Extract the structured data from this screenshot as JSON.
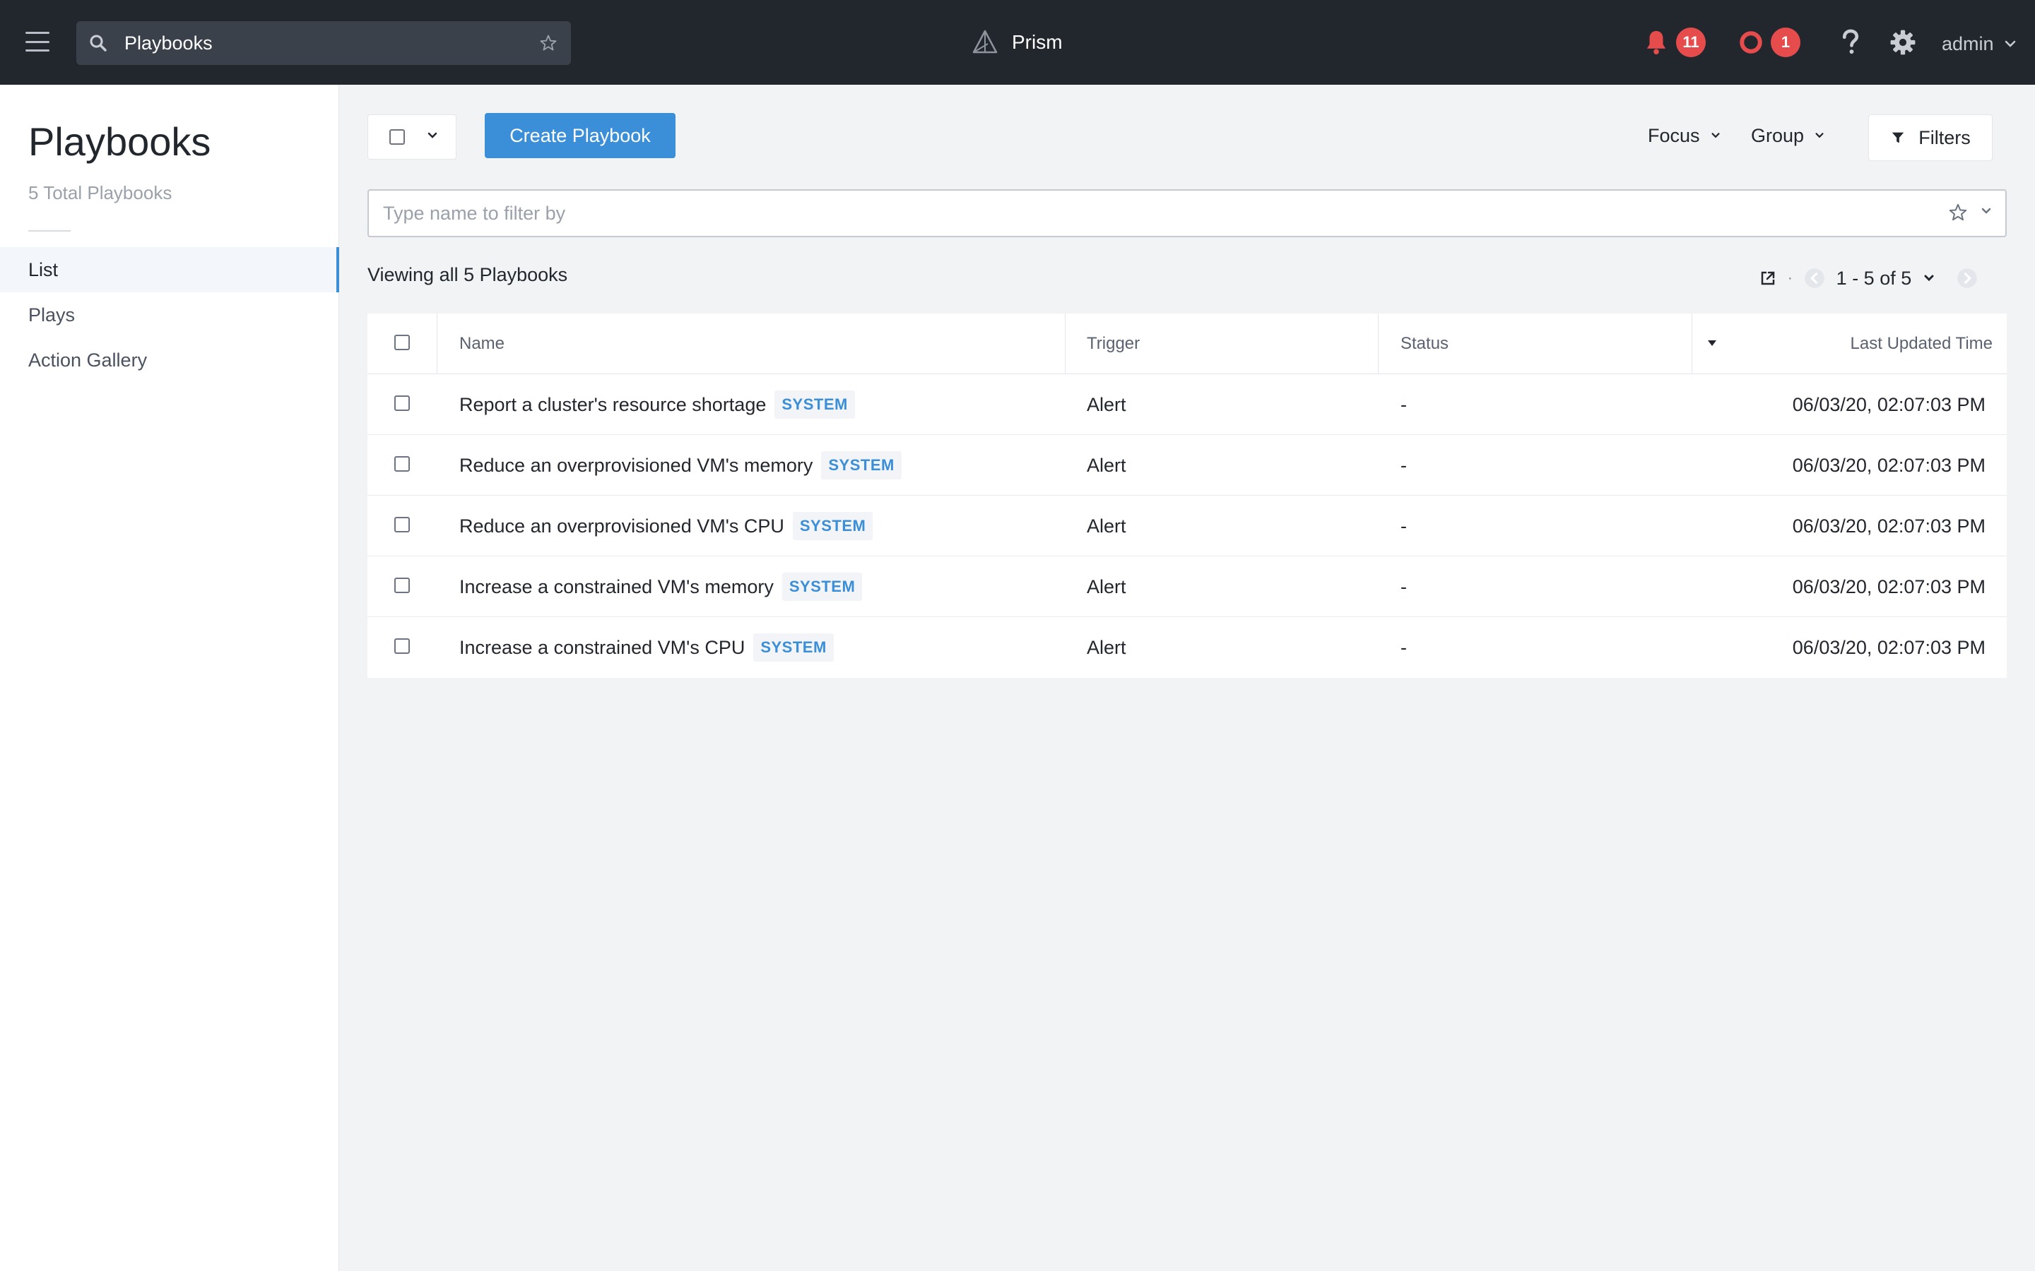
{
  "topbar": {
    "search_value": "Playbooks",
    "brand": "Prism",
    "alerts_count": "11",
    "events_count": "1",
    "user": "admin"
  },
  "sidebar": {
    "title": "Playbooks",
    "subtitle": "5 Total Playbooks",
    "items": [
      {
        "label": "List",
        "active": true
      },
      {
        "label": "Plays",
        "active": false
      },
      {
        "label": "Action Gallery",
        "active": false
      }
    ]
  },
  "toolbar": {
    "create_label": "Create Playbook",
    "focus_label": "Focus",
    "group_label": "Group",
    "filters_label": "Filters"
  },
  "filter": {
    "placeholder": "Type name to filter by"
  },
  "summary": {
    "viewing_text": "Viewing all 5 Playbooks",
    "pager_text": "1 - 5 of 5"
  },
  "table": {
    "columns": {
      "name": "Name",
      "trigger": "Trigger",
      "status": "Status",
      "updated": "Last Updated Time"
    },
    "rows": [
      {
        "name": "Report a cluster's resource shortage",
        "tag": "SYSTEM",
        "trigger": "Alert",
        "status": "-",
        "updated": "06/03/20, 02:07:03 PM"
      },
      {
        "name": "Reduce an overprovisioned VM's memory",
        "tag": "SYSTEM",
        "trigger": "Alert",
        "status": "-",
        "updated": "06/03/20, 02:07:03 PM"
      },
      {
        "name": "Reduce an overprovisioned VM's CPU",
        "tag": "SYSTEM",
        "trigger": "Alert",
        "status": "-",
        "updated": "06/03/20, 02:07:03 PM"
      },
      {
        "name": "Increase a constrained VM's memory",
        "tag": "SYSTEM",
        "trigger": "Alert",
        "status": "-",
        "updated": "06/03/20, 02:07:03 PM"
      },
      {
        "name": "Increase a constrained VM's CPU",
        "tag": "SYSTEM",
        "trigger": "Alert",
        "status": "-",
        "updated": "06/03/20, 02:07:03 PM"
      }
    ]
  },
  "colors": {
    "topbar_bg": "#22272e",
    "accent": "#3a8fd8",
    "badge": "#e74c4c"
  }
}
